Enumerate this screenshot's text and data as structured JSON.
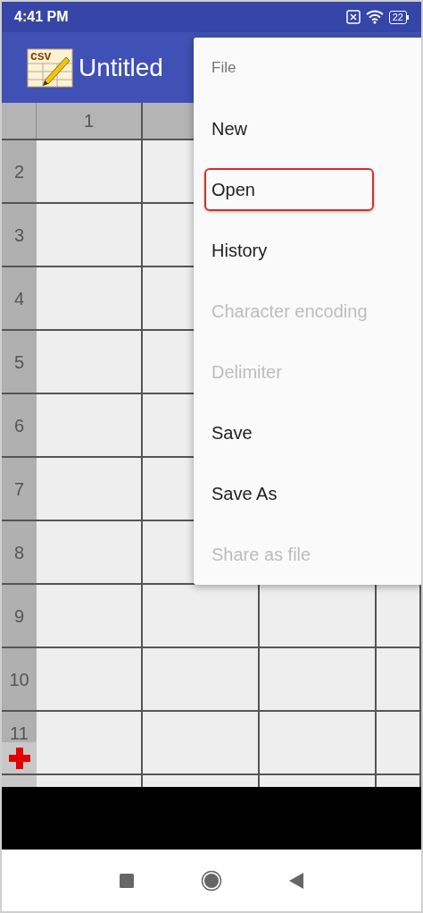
{
  "status_bar": {
    "time": "4:41 PM",
    "battery": "22"
  },
  "app_bar": {
    "logo_text": "csv",
    "title": "Untitled"
  },
  "grid": {
    "column_headers": [
      "1"
    ],
    "row_headers": [
      "2",
      "3",
      "4",
      "5",
      "6",
      "7",
      "8",
      "9",
      "10",
      "11"
    ]
  },
  "menu": {
    "header": "File",
    "items": [
      {
        "label": "New",
        "disabled": false,
        "highlighted": false
      },
      {
        "label": "Open",
        "disabled": false,
        "highlighted": true
      },
      {
        "label": "History",
        "disabled": false,
        "highlighted": false
      },
      {
        "label": "Character encoding",
        "disabled": true,
        "highlighted": false
      },
      {
        "label": "Delimiter",
        "disabled": true,
        "highlighted": false
      },
      {
        "label": "Save",
        "disabled": false,
        "highlighted": false
      },
      {
        "label": "Save As",
        "disabled": false,
        "highlighted": false
      },
      {
        "label": "Share as file",
        "disabled": true,
        "highlighted": false
      }
    ]
  }
}
